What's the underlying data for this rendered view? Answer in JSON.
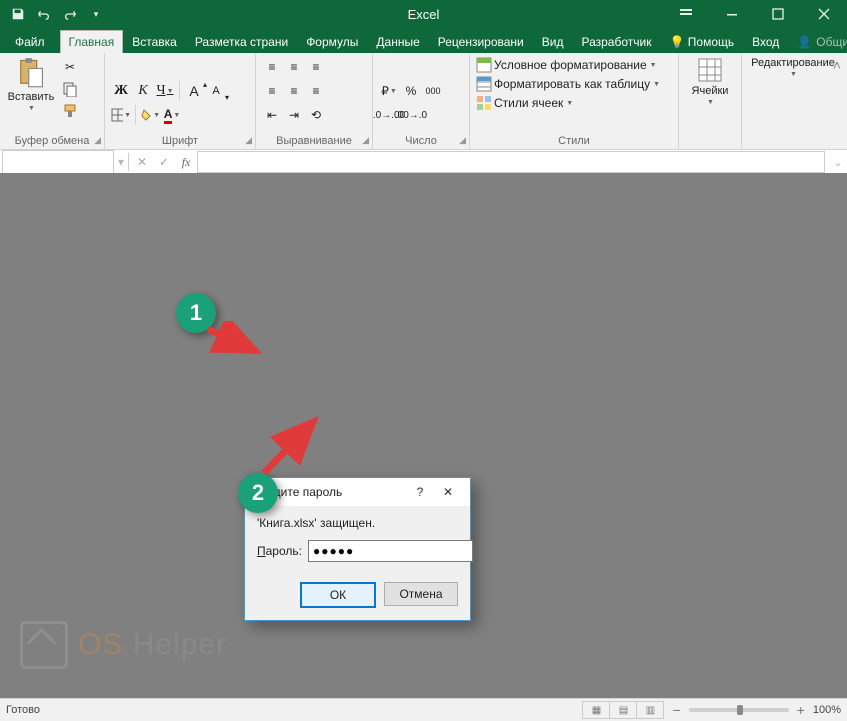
{
  "title": "Excel",
  "qat": {
    "customize_tip": "▾"
  },
  "tabs": {
    "file": "Файл",
    "home": "Главная",
    "insert": "Вставка",
    "layout": "Разметка страни",
    "formulas": "Формулы",
    "data": "Данные",
    "review": "Рецензировани",
    "view": "Вид",
    "developer": "Разработчик",
    "help": "Помощь",
    "signin": "Вход",
    "share": "Общий доступ"
  },
  "ribbon": {
    "clipboard": {
      "paste": "Вставить",
      "label": "Буфер обмена"
    },
    "font": {
      "label": "Шрифт",
      "bold": "Ж",
      "italic": "К",
      "underline": "Ч",
      "grow": "A",
      "shrink": "A"
    },
    "align": {
      "label": "Выравнивание"
    },
    "number": {
      "label": "Число",
      "percent": "%",
      "comma": "000"
    },
    "styles": {
      "label": "Стили",
      "cond": "Условное форматирование",
      "table": "Форматировать как таблицу",
      "cell": "Стили ячеек"
    },
    "cells": {
      "label": "Ячейки"
    },
    "editing": {
      "label": "Редактирование"
    }
  },
  "formula_bar": {
    "fx": "fx"
  },
  "dialog": {
    "title": "Введите пароль",
    "message": "'Книга.xlsx' защищен.",
    "password_label_u": "П",
    "password_label_rest": "ароль:",
    "password_value": "●●●●●",
    "ok": "ОК",
    "cancel": "Отмена",
    "help": "?",
    "close": "✕"
  },
  "callouts": {
    "one": "1",
    "two": "2"
  },
  "watermark": {
    "os": "OS",
    "helper": "Helper"
  },
  "status": {
    "ready": "Готово",
    "zoom": "100%"
  }
}
